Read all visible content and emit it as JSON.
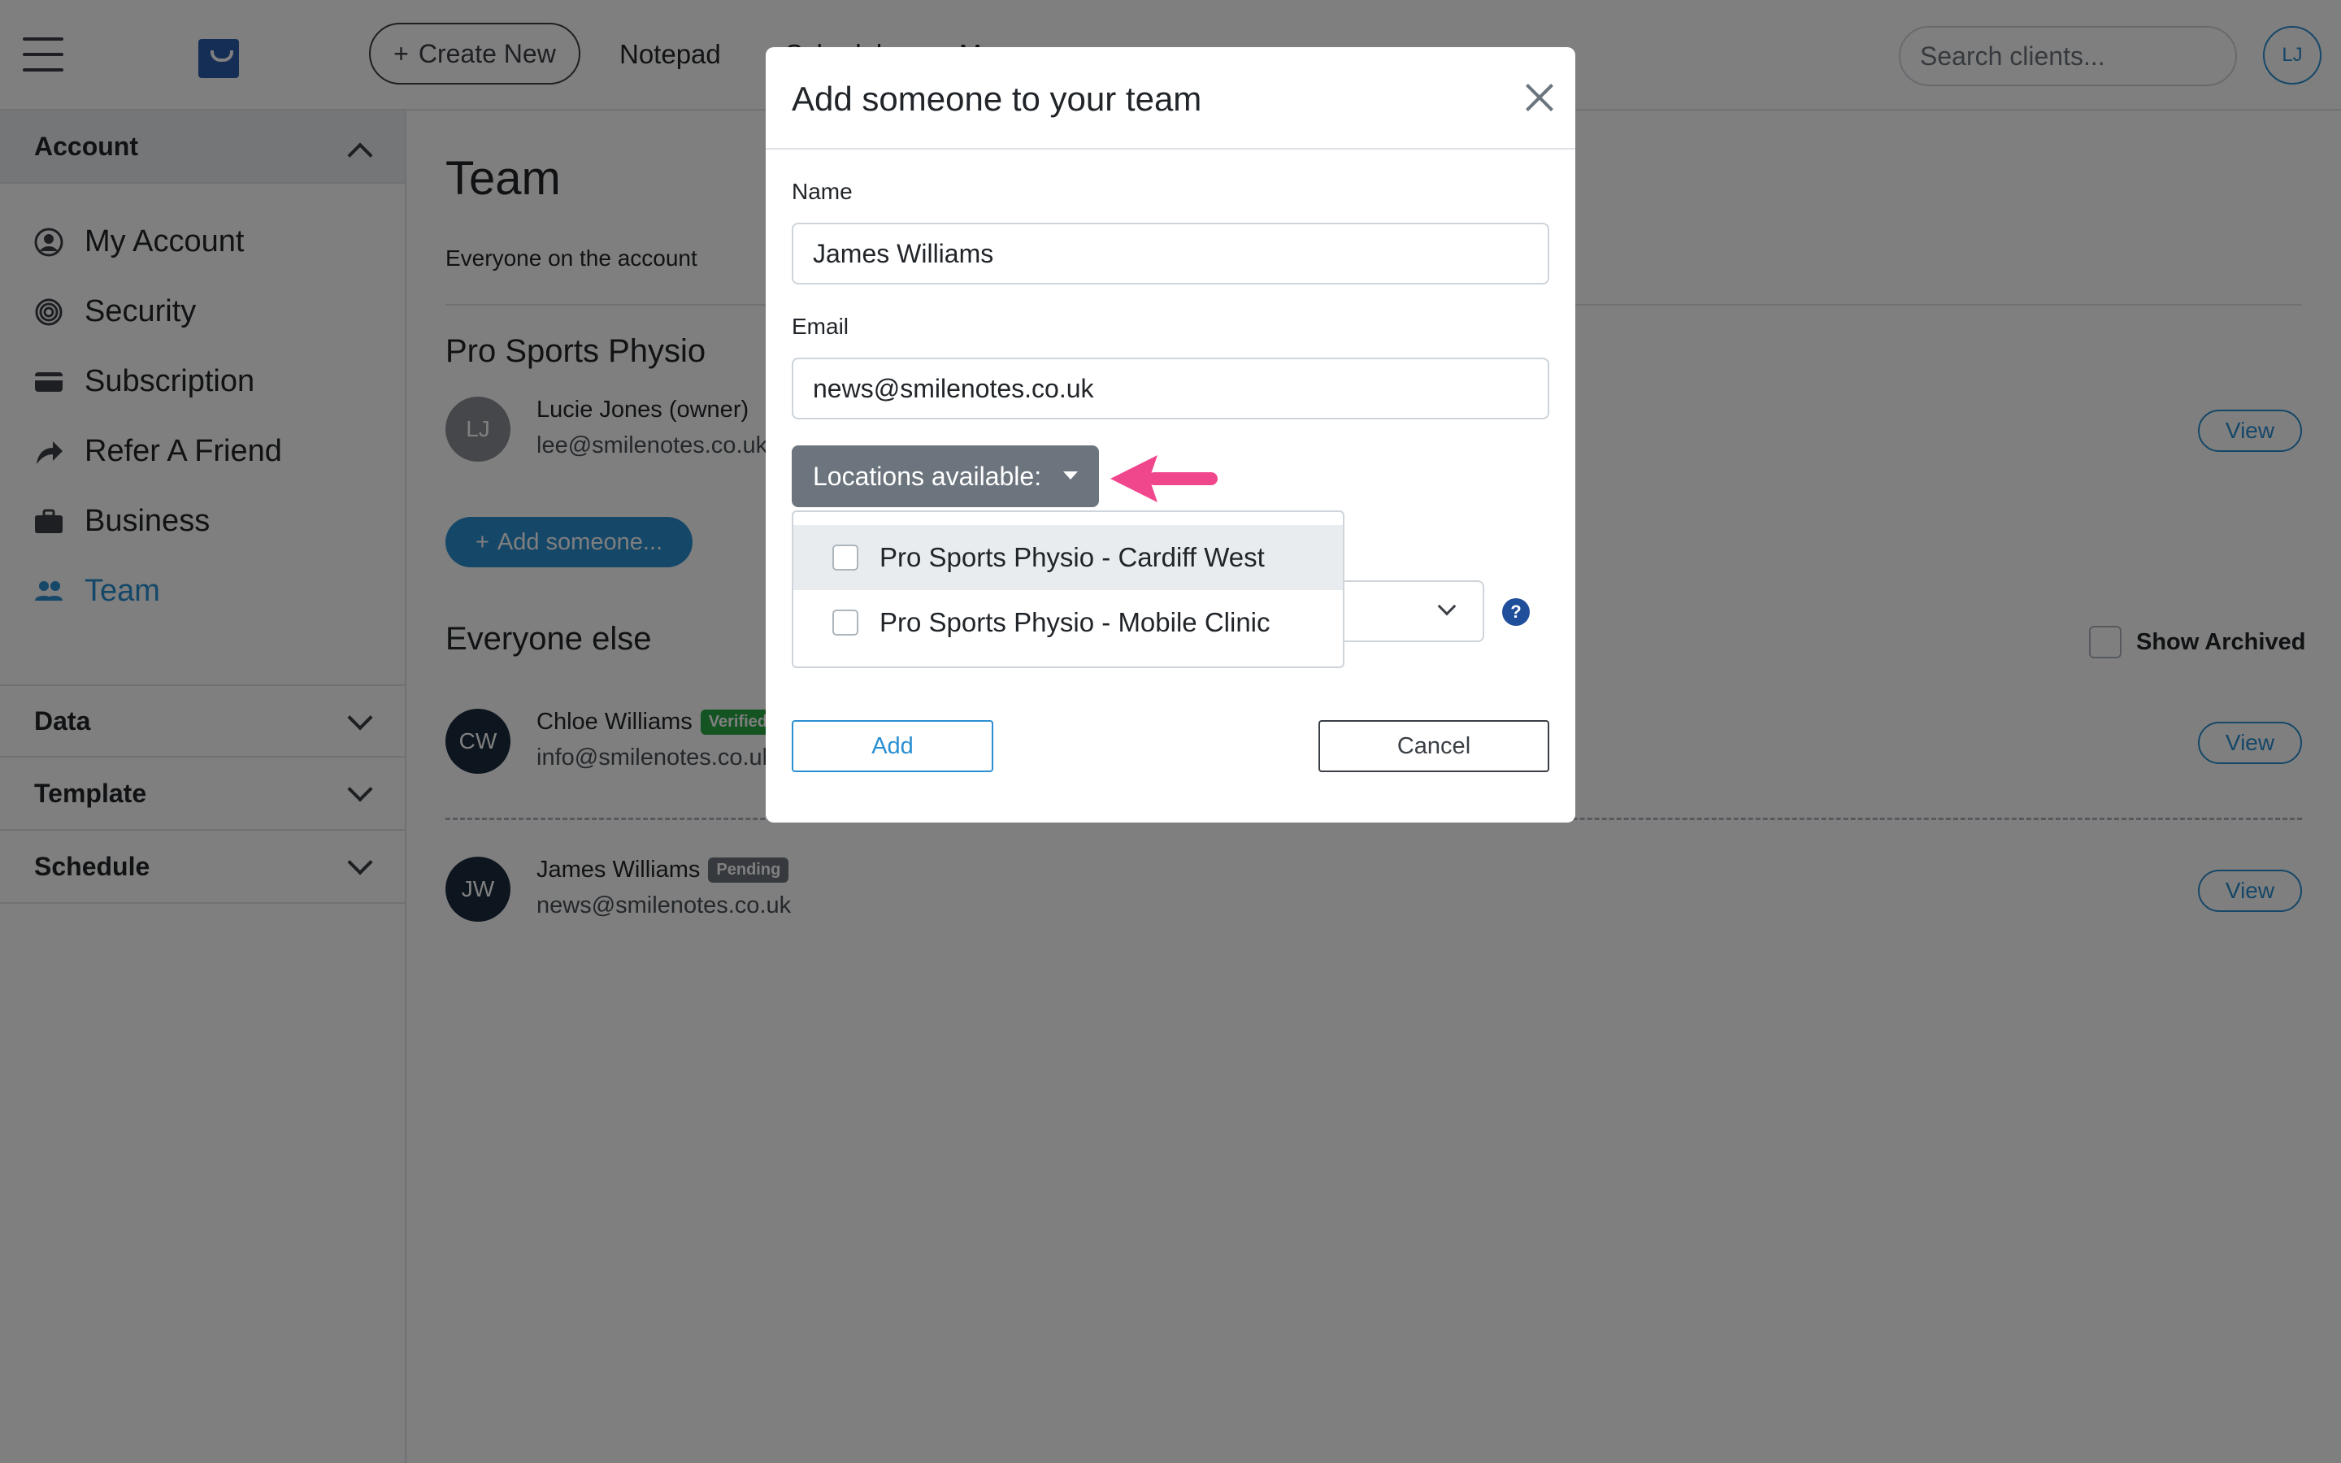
{
  "topbar": {
    "create_label": "Create New",
    "create_icon": "+",
    "nav": [
      "Notepad",
      "Scheduler",
      "M"
    ],
    "search_placeholder": "Search clients...",
    "user_initials": "LJ"
  },
  "sidebar": {
    "account_label": "Account",
    "items": [
      {
        "label": "My Account",
        "icon": "user-circle-icon"
      },
      {
        "label": "Security",
        "icon": "fingerprint-icon"
      },
      {
        "label": "Subscription",
        "icon": "credit-card-icon"
      },
      {
        "label": "Refer A Friend",
        "icon": "share-arrow-icon"
      },
      {
        "label": "Business",
        "icon": "briefcase-icon"
      },
      {
        "label": "Team",
        "icon": "users-icon"
      }
    ],
    "sections": [
      "Data",
      "Template",
      "Schedule"
    ]
  },
  "main": {
    "title": "Team",
    "subtitle": "Everyone on the account",
    "business_name": "Pro Sports Physio",
    "owner": {
      "initials": "LJ",
      "name": "Lucie Jones (owner)",
      "email": "lee@smilenotes.co.uk"
    },
    "add_someone_label": "Add someone...",
    "add_someone_icon": "+",
    "everyone_else_label": "Everyone else",
    "show_archived_label": "Show Archived",
    "members": [
      {
        "initials": "CW",
        "name": "Chloe Williams",
        "badge": "Verified",
        "email": "info@smilenotes.co.uk"
      },
      {
        "initials": "JW",
        "name": "James Williams",
        "badge": "Pending",
        "email": "news@smilenotes.co.uk"
      }
    ],
    "view_label": "View"
  },
  "modal": {
    "title": "Add someone to your team",
    "name_label": "Name",
    "name_value": "James Williams",
    "email_label": "Email",
    "email_value": "news@smilenotes.co.uk",
    "locations_label": "Locations available:",
    "locations": [
      "Pro Sports Physio - Cardiff West",
      "Pro Sports Physio - Mobile Clinic"
    ],
    "help_icon": "?",
    "add_label": "Add",
    "cancel_label": "Cancel"
  },
  "colors": {
    "accent": "#2a8fd1",
    "annotation_arrow": "#f0478c",
    "verified": "#28a745",
    "pending": "#6c757d",
    "avatar_dark": "#1b2a3f",
    "avatar_owner": "#8a8f94"
  }
}
